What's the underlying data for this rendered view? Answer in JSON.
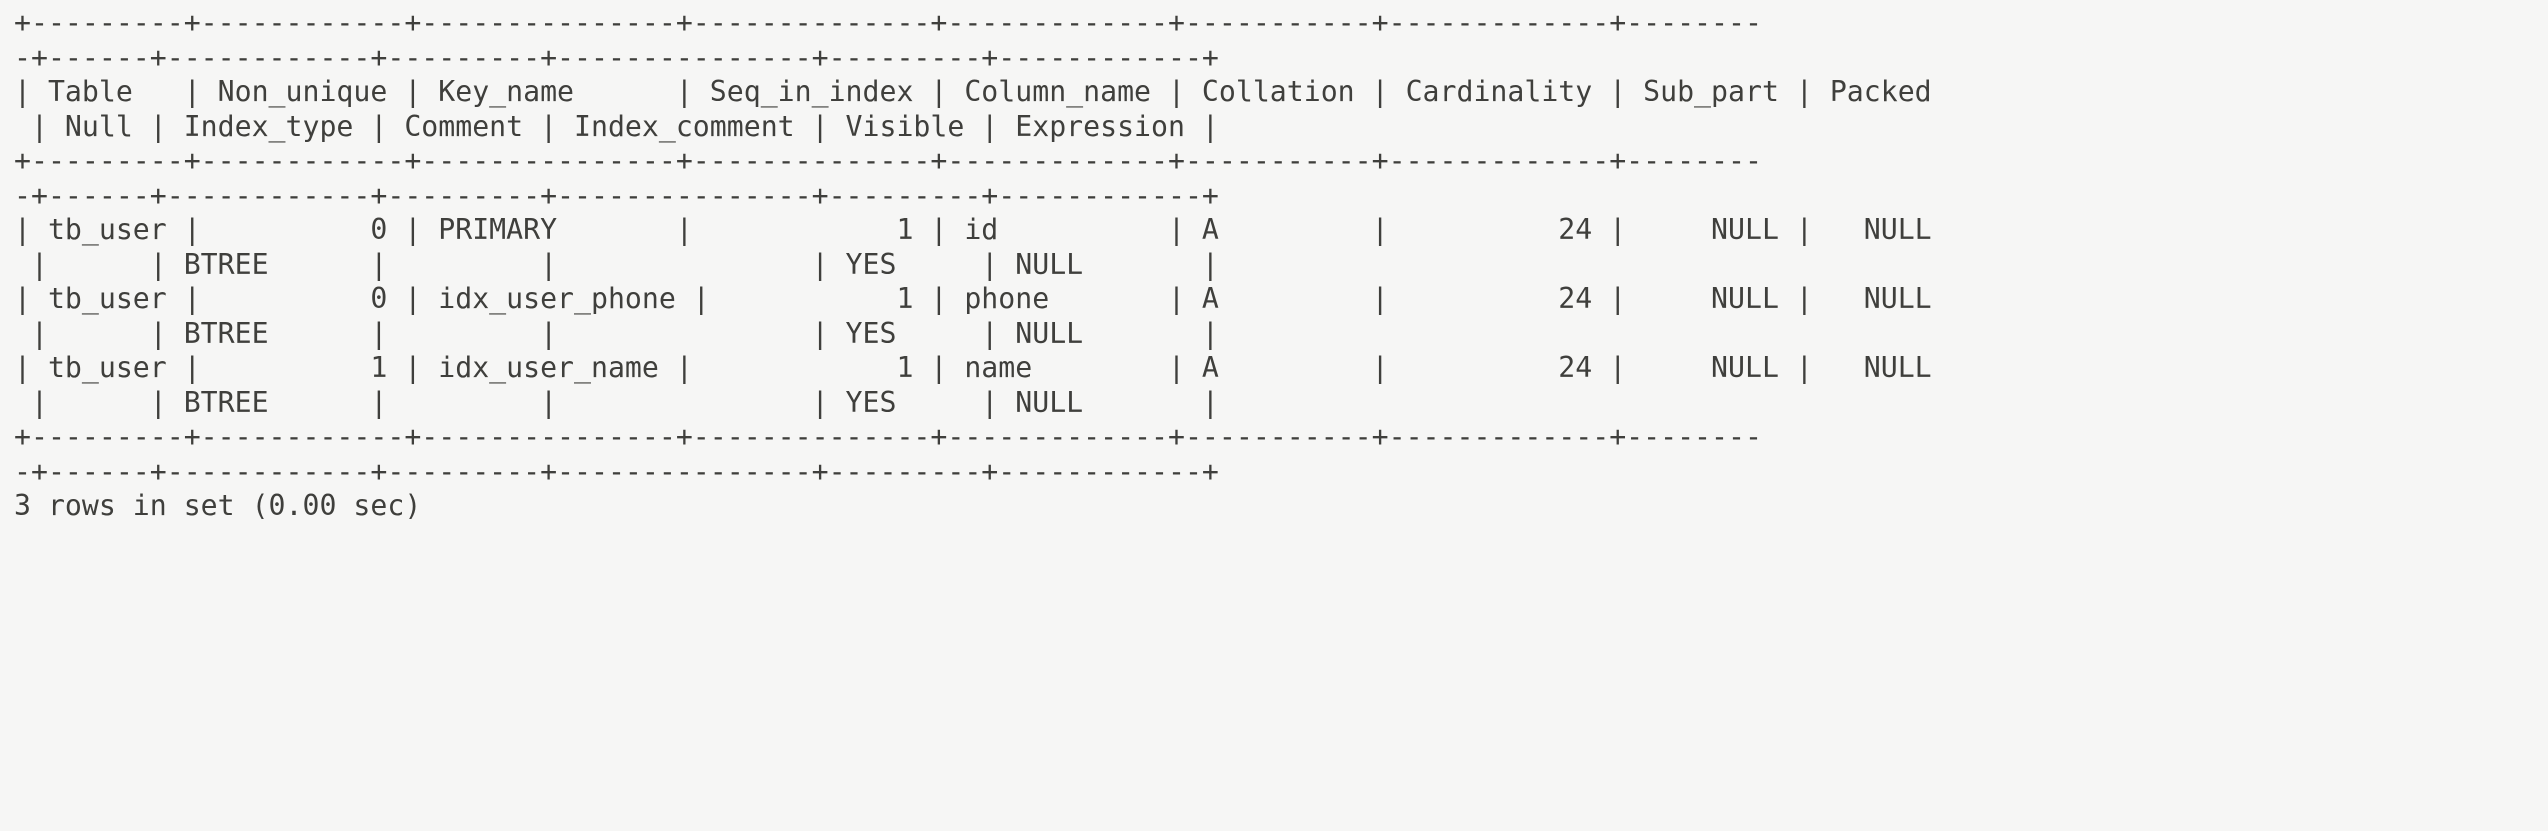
{
  "terminal": {
    "background_color": "#f6f6f5",
    "text_color": "#3f3f3c",
    "command_context": "mysql"
  },
  "table": {
    "columns": [
      {
        "name": "Table",
        "width": 9
      },
      {
        "name": "Non_unique",
        "width": 12
      },
      {
        "name": "Key_name",
        "width": 15
      },
      {
        "name": "Seq_in_index",
        "width": 14
      },
      {
        "name": "Column_name",
        "width": 13
      },
      {
        "name": "Collation",
        "width": 11
      },
      {
        "name": "Cardinality",
        "width": 13
      },
      {
        "name": "Sub_part",
        "width": 10
      },
      {
        "name": "Packed",
        "width": 8
      },
      {
        "name": "Null",
        "width": 6
      },
      {
        "name": "Index_type",
        "width": 12
      },
      {
        "name": "Comment",
        "width": 9
      },
      {
        "name": "Index_comment",
        "width": 15
      },
      {
        "name": "Visible",
        "width": 9
      },
      {
        "name": "Expression",
        "width": 12
      }
    ],
    "rows": [
      {
        "Table": "tb_user",
        "Non_unique": "0",
        "Key_name": "PRIMARY",
        "Seq_in_index": "1",
        "Column_name": "id",
        "Collation": "A",
        "Cardinality": "24",
        "Sub_part": "NULL",
        "Packed": "NULL",
        "Null": "",
        "Index_type": "BTREE",
        "Comment": "",
        "Index_comment": "",
        "Visible": "YES",
        "Expression": "NULL"
      },
      {
        "Table": "tb_user",
        "Non_unique": "0",
        "Key_name": "idx_user_phone",
        "Seq_in_index": "1",
        "Column_name": "phone",
        "Collation": "A",
        "Cardinality": "24",
        "Sub_part": "NULL",
        "Packed": "NULL",
        "Null": "",
        "Index_type": "BTREE",
        "Comment": "",
        "Index_comment": "",
        "Visible": "YES",
        "Expression": "NULL"
      },
      {
        "Table": "tb_user",
        "Non_unique": "1",
        "Key_name": "idx_user_name",
        "Seq_in_index": "1",
        "Column_name": "name",
        "Collation": "A",
        "Cardinality": "24",
        "Sub_part": "NULL",
        "Packed": "NULL",
        "Null": "",
        "Index_type": "BTREE",
        "Comment": "",
        "Index_comment": "",
        "Visible": "YES",
        "Expression": "NULL"
      }
    ]
  },
  "status": {
    "row_count_text": "3 rows in set (0.00 sec)"
  },
  "raw_lines": [
    "+---------+------------+---------------+--------------+-------------+-----------+-------------+----------+--------+------+------------+---------+---------------+---------+------------+",
    "| Table   | Non_unique | Key_name      | Seq_in_index | Column_name | Collation | Cardinality | Sub_part | Packed | Null | Index_type | Comment | Index_comment | Visible | Expression |",
    "+---------+------------+---------------+--------------+-------------+-----------+-------------+----------+--------+------+------------+---------+---------------+---------+------------+",
    "| tb_user |          0 | PRIMARY       |            1 | id          | A         |          24 |     NULL |   NULL |      | BTREE      |         |               | YES     | NULL       |",
    "| tb_user |          0 | idx_user_phone |           1 | phone       | A         |          24 |     NULL |   NULL |      | BTREE      |         |               | YES     | NULL       |",
    "| tb_user |          1 | idx_user_name |            1 | name        | A         |          24 |     NULL |   NULL |      | BTREE      |         |               | YES     | NULL       |",
    "+---------+------------+---------------+--------------+-------------+-----------+-------------+----------+--------+------+------------+---------+---------------+---------+------------+",
    "3 rows in set (0.00 sec)"
  ],
  "display_lines": [
    "+---------+------------+---------------+--------------+-------------+-----------+-------------+--------",
    "-+------+------------+---------+---------------+---------+------------+",
    "| Table   | Non_unique | Key_name      | Seq_in_index | Column_name | Collation | Cardinality | Sub_part | Packed",
    " | Null | Index_type | Comment | Index_comment | Visible | Expression |",
    "+---------+------------+---------------+--------------+-------------+-----------+-------------+--------",
    "-+------+------------+---------+---------------+---------+------------+",
    "| tb_user |          0 | PRIMARY       |            1 | id          | A         |          24 |     NULL |   NULL",
    " |      | BTREE      |         |               | YES     | NULL       |",
    "| tb_user |          0 | idx_user_phone |           1 | phone       | A         |          24 |     NULL |   NULL",
    " |      | BTREE      |         |               | YES     | NULL       |",
    "| tb_user |          1 | idx_user_name |            1 | name        | A         |          24 |     NULL |   NULL",
    " |      | BTREE      |         |               | YES     | NULL       |",
    "+---------+------------+---------------+--------------+-------------+-----------+-------------+--------",
    "-+------+------------+---------+---------------+---------+------------+",
    "3 rows in set (0.00 sec)"
  ]
}
